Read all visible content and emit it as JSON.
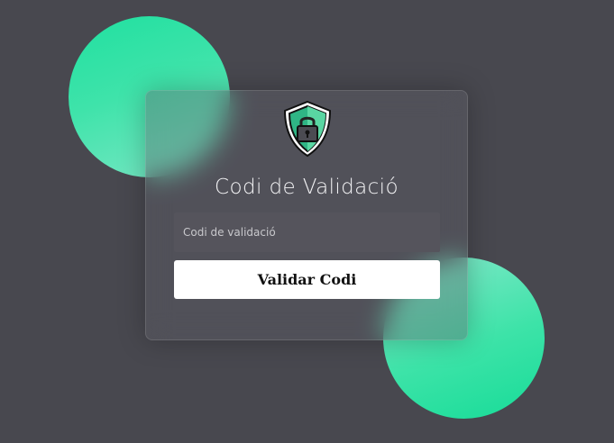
{
  "background_color": "#48484f",
  "accent_color": "#2ee3a3",
  "card": {
    "icon": "shield-lock-icon",
    "title": "Codi de Validació",
    "input": {
      "placeholder": "Codi de validació",
      "value": ""
    },
    "button_label": "Validar Codi"
  }
}
